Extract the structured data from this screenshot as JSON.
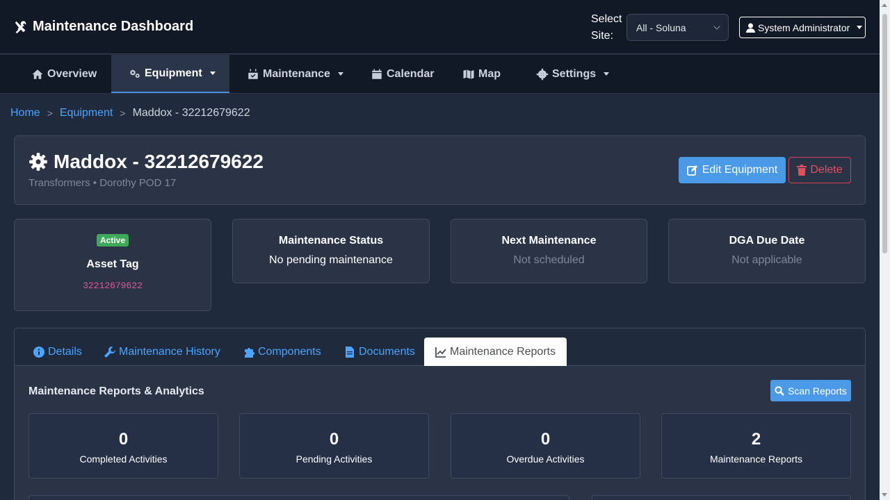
{
  "app": {
    "title": "Maintenance Dashboard",
    "site_label": "Select Site:",
    "site_value": "All - Soluna",
    "user": "System Administrator"
  },
  "nav": [
    {
      "label": "Overview",
      "icon": "home-icon"
    },
    {
      "label": "Equipment",
      "icon": "gears-icon",
      "active": true
    },
    {
      "label": "Maintenance",
      "icon": "calendar-check-icon"
    },
    {
      "label": "Calendar",
      "icon": "calendar-icon"
    },
    {
      "label": "Map",
      "icon": "map-icon"
    },
    {
      "label": "Settings",
      "icon": "gear-icon"
    }
  ],
  "breadcrumb": {
    "home": "Home",
    "equipment": "Equipment",
    "current": "Maddox - 32212679622",
    "separator": ">"
  },
  "equipment": {
    "title": "Maddox - 32212679622",
    "subtitle": "Transformers • Dorothy POD 17",
    "edit_label": "Edit Equipment",
    "delete_label": "Delete"
  },
  "stats": {
    "status_badge": "Active",
    "asset_tag_label": "Asset Tag",
    "asset_tag_value": "32212679622",
    "maint_status_label": "Maintenance Status",
    "maint_status_value": "No pending maintenance",
    "next_maint_label": "Next Maintenance",
    "next_maint_value": "Not scheduled",
    "dga_label": "DGA Due Date",
    "dga_value": "Not applicable"
  },
  "tabs": [
    {
      "label": "Details",
      "icon": "info-icon"
    },
    {
      "label": "Maintenance History",
      "icon": "wrench-icon"
    },
    {
      "label": "Components",
      "icon": "puzzle-icon"
    },
    {
      "label": "Documents",
      "icon": "file-icon"
    },
    {
      "label": "Maintenance Reports",
      "icon": "chart-line-icon",
      "active": true
    }
  ],
  "reports": {
    "title": "Maintenance Reports & Analytics",
    "scan_label": "Scan Reports",
    "metrics": [
      {
        "value": "0",
        "label": "Completed Activities"
      },
      {
        "value": "0",
        "label": "Pending Activities"
      },
      {
        "value": "0",
        "label": "Overdue Activities"
      },
      {
        "value": "2",
        "label": "Maintenance Reports"
      }
    ]
  },
  "colors": {
    "background": "#1f2a3c",
    "card": "#2b3447",
    "accent": "#4a9ae8",
    "link": "#4da3ff",
    "danger": "#d9404f",
    "success": "#3fa95a"
  }
}
